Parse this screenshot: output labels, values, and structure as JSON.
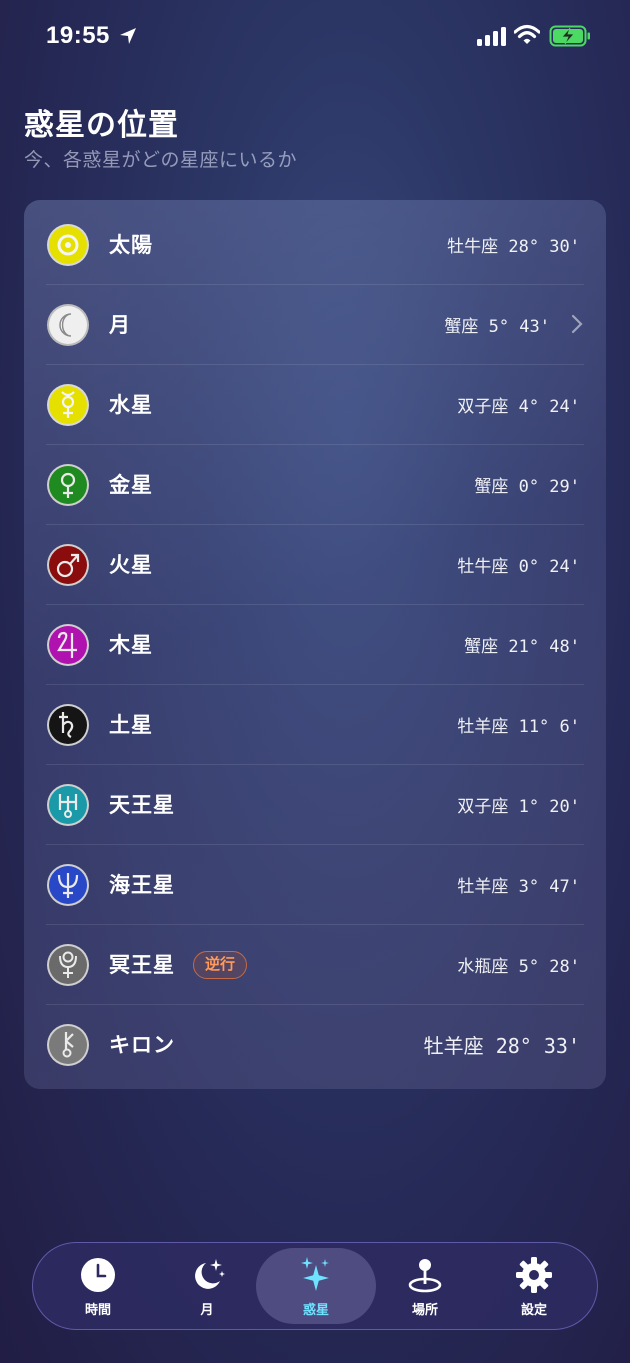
{
  "status_bar": {
    "time": "19:55"
  },
  "header": {
    "title": "惑星の位置",
    "subtitle": "今、各惑星がどの星座にいるか"
  },
  "planets": [
    {
      "name": "太陽",
      "position": "牡牛座 28° 30'",
      "icon": "sun-icon",
      "color": "#e6e000"
    },
    {
      "name": "月",
      "position": "蟹座 5° 43'",
      "icon": "moon-icon",
      "color": "#e8e8e8"
    },
    {
      "name": "水星",
      "position": "双子座 4° 24'",
      "icon": "mercury-icon",
      "color": "#e6e000"
    },
    {
      "name": "金星",
      "position": "蟹座 0° 29'",
      "icon": "venus-icon",
      "color": "#1f8a1f"
    },
    {
      "name": "火星",
      "position": "牡牛座 0° 24'",
      "icon": "mars-icon",
      "color": "#8a0c0c"
    },
    {
      "name": "木星",
      "position": "蟹座 21° 48'",
      "icon": "jupiter-icon",
      "color": "#b012b0"
    },
    {
      "name": "土星",
      "position": "牡羊座 11° 6'",
      "icon": "saturn-icon",
      "color": "#151515"
    },
    {
      "name": "天王星",
      "position": "双子座 1° 20'",
      "icon": "uranus-icon",
      "color": "#1a9aa8"
    },
    {
      "name": "海王星",
      "position": "牡羊座 3° 47'",
      "icon": "neptune-icon",
      "color": "#2848c8"
    },
    {
      "name": "冥王星",
      "position": "水瓶座 5° 28'",
      "icon": "pluto-icon",
      "color": "#6a6a6a",
      "badge": "逆行"
    },
    {
      "name": "キロン",
      "position": "牡羊座 28° 33'",
      "icon": "chiron-icon",
      "color": "#7a7a7a"
    }
  ],
  "tabs": [
    {
      "label": "時間",
      "icon": "clock-icon"
    },
    {
      "label": "月",
      "icon": "moon-stars-icon"
    },
    {
      "label": "惑星",
      "icon": "sparkles-icon",
      "active": true,
      "accent": "#6fe2ff"
    },
    {
      "label": "場所",
      "icon": "map-pin-icon"
    },
    {
      "label": "設定",
      "icon": "gear-icon"
    }
  ]
}
